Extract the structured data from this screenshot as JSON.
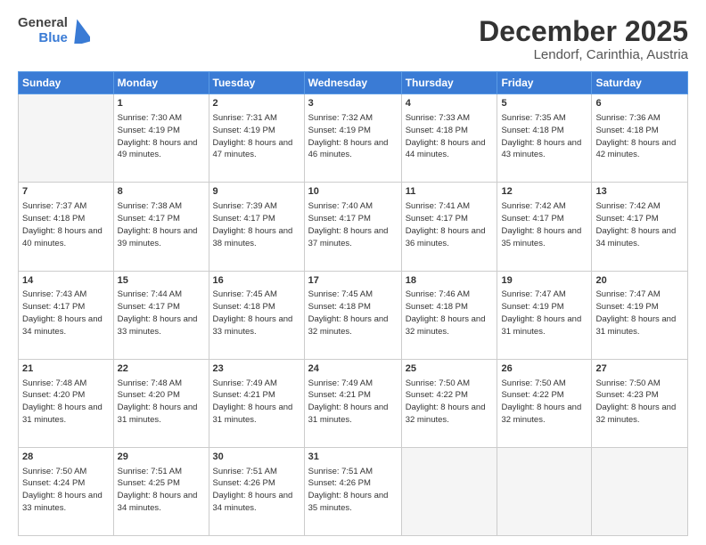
{
  "logo": {
    "general": "General",
    "blue": "Blue"
  },
  "title": {
    "month": "December 2025",
    "location": "Lendorf, Carinthia, Austria"
  },
  "days_of_week": [
    "Sunday",
    "Monday",
    "Tuesday",
    "Wednesday",
    "Thursday",
    "Friday",
    "Saturday"
  ],
  "weeks": [
    [
      {
        "day": "",
        "sunrise": "",
        "sunset": "",
        "daylight": ""
      },
      {
        "day": "1",
        "sunrise": "Sunrise: 7:30 AM",
        "sunset": "Sunset: 4:19 PM",
        "daylight": "Daylight: 8 hours and 49 minutes."
      },
      {
        "day": "2",
        "sunrise": "Sunrise: 7:31 AM",
        "sunset": "Sunset: 4:19 PM",
        "daylight": "Daylight: 8 hours and 47 minutes."
      },
      {
        "day": "3",
        "sunrise": "Sunrise: 7:32 AM",
        "sunset": "Sunset: 4:19 PM",
        "daylight": "Daylight: 8 hours and 46 minutes."
      },
      {
        "day": "4",
        "sunrise": "Sunrise: 7:33 AM",
        "sunset": "Sunset: 4:18 PM",
        "daylight": "Daylight: 8 hours and 44 minutes."
      },
      {
        "day": "5",
        "sunrise": "Sunrise: 7:35 AM",
        "sunset": "Sunset: 4:18 PM",
        "daylight": "Daylight: 8 hours and 43 minutes."
      },
      {
        "day": "6",
        "sunrise": "Sunrise: 7:36 AM",
        "sunset": "Sunset: 4:18 PM",
        "daylight": "Daylight: 8 hours and 42 minutes."
      }
    ],
    [
      {
        "day": "7",
        "sunrise": "Sunrise: 7:37 AM",
        "sunset": "Sunset: 4:18 PM",
        "daylight": "Daylight: 8 hours and 40 minutes."
      },
      {
        "day": "8",
        "sunrise": "Sunrise: 7:38 AM",
        "sunset": "Sunset: 4:17 PM",
        "daylight": "Daylight: 8 hours and 39 minutes."
      },
      {
        "day": "9",
        "sunrise": "Sunrise: 7:39 AM",
        "sunset": "Sunset: 4:17 PM",
        "daylight": "Daylight: 8 hours and 38 minutes."
      },
      {
        "day": "10",
        "sunrise": "Sunrise: 7:40 AM",
        "sunset": "Sunset: 4:17 PM",
        "daylight": "Daylight: 8 hours and 37 minutes."
      },
      {
        "day": "11",
        "sunrise": "Sunrise: 7:41 AM",
        "sunset": "Sunset: 4:17 PM",
        "daylight": "Daylight: 8 hours and 36 minutes."
      },
      {
        "day": "12",
        "sunrise": "Sunrise: 7:42 AM",
        "sunset": "Sunset: 4:17 PM",
        "daylight": "Daylight: 8 hours and 35 minutes."
      },
      {
        "day": "13",
        "sunrise": "Sunrise: 7:42 AM",
        "sunset": "Sunset: 4:17 PM",
        "daylight": "Daylight: 8 hours and 34 minutes."
      }
    ],
    [
      {
        "day": "14",
        "sunrise": "Sunrise: 7:43 AM",
        "sunset": "Sunset: 4:17 PM",
        "daylight": "Daylight: 8 hours and 34 minutes."
      },
      {
        "day": "15",
        "sunrise": "Sunrise: 7:44 AM",
        "sunset": "Sunset: 4:17 PM",
        "daylight": "Daylight: 8 hours and 33 minutes."
      },
      {
        "day": "16",
        "sunrise": "Sunrise: 7:45 AM",
        "sunset": "Sunset: 4:18 PM",
        "daylight": "Daylight: 8 hours and 33 minutes."
      },
      {
        "day": "17",
        "sunrise": "Sunrise: 7:45 AM",
        "sunset": "Sunset: 4:18 PM",
        "daylight": "Daylight: 8 hours and 32 minutes."
      },
      {
        "day": "18",
        "sunrise": "Sunrise: 7:46 AM",
        "sunset": "Sunset: 4:18 PM",
        "daylight": "Daylight: 8 hours and 32 minutes."
      },
      {
        "day": "19",
        "sunrise": "Sunrise: 7:47 AM",
        "sunset": "Sunset: 4:19 PM",
        "daylight": "Daylight: 8 hours and 31 minutes."
      },
      {
        "day": "20",
        "sunrise": "Sunrise: 7:47 AM",
        "sunset": "Sunset: 4:19 PM",
        "daylight": "Daylight: 8 hours and 31 minutes."
      }
    ],
    [
      {
        "day": "21",
        "sunrise": "Sunrise: 7:48 AM",
        "sunset": "Sunset: 4:20 PM",
        "daylight": "Daylight: 8 hours and 31 minutes."
      },
      {
        "day": "22",
        "sunrise": "Sunrise: 7:48 AM",
        "sunset": "Sunset: 4:20 PM",
        "daylight": "Daylight: 8 hours and 31 minutes."
      },
      {
        "day": "23",
        "sunrise": "Sunrise: 7:49 AM",
        "sunset": "Sunset: 4:21 PM",
        "daylight": "Daylight: 8 hours and 31 minutes."
      },
      {
        "day": "24",
        "sunrise": "Sunrise: 7:49 AM",
        "sunset": "Sunset: 4:21 PM",
        "daylight": "Daylight: 8 hours and 31 minutes."
      },
      {
        "day": "25",
        "sunrise": "Sunrise: 7:50 AM",
        "sunset": "Sunset: 4:22 PM",
        "daylight": "Daylight: 8 hours and 32 minutes."
      },
      {
        "day": "26",
        "sunrise": "Sunrise: 7:50 AM",
        "sunset": "Sunset: 4:22 PM",
        "daylight": "Daylight: 8 hours and 32 minutes."
      },
      {
        "day": "27",
        "sunrise": "Sunrise: 7:50 AM",
        "sunset": "Sunset: 4:23 PM",
        "daylight": "Daylight: 8 hours and 32 minutes."
      }
    ],
    [
      {
        "day": "28",
        "sunrise": "Sunrise: 7:50 AM",
        "sunset": "Sunset: 4:24 PM",
        "daylight": "Daylight: 8 hours and 33 minutes."
      },
      {
        "day": "29",
        "sunrise": "Sunrise: 7:51 AM",
        "sunset": "Sunset: 4:25 PM",
        "daylight": "Daylight: 8 hours and 34 minutes."
      },
      {
        "day": "30",
        "sunrise": "Sunrise: 7:51 AM",
        "sunset": "Sunset: 4:26 PM",
        "daylight": "Daylight: 8 hours and 34 minutes."
      },
      {
        "day": "31",
        "sunrise": "Sunrise: 7:51 AM",
        "sunset": "Sunset: 4:26 PM",
        "daylight": "Daylight: 8 hours and 35 minutes."
      },
      {
        "day": "",
        "sunrise": "",
        "sunset": "",
        "daylight": ""
      },
      {
        "day": "",
        "sunrise": "",
        "sunset": "",
        "daylight": ""
      },
      {
        "day": "",
        "sunrise": "",
        "sunset": "",
        "daylight": ""
      }
    ]
  ]
}
